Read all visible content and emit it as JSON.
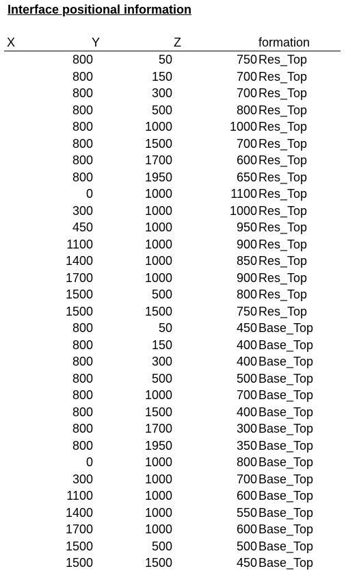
{
  "title": "Interface positional information",
  "columns": {
    "x": "X",
    "y": "Y",
    "z": "Z",
    "formation": "formation"
  },
  "rows": [
    {
      "x": "800",
      "y": "50",
      "z": "750",
      "formation": "Res_Top"
    },
    {
      "x": "800",
      "y": "150",
      "z": "700",
      "formation": "Res_Top"
    },
    {
      "x": "800",
      "y": "300",
      "z": "700",
      "formation": "Res_Top"
    },
    {
      "x": "800",
      "y": "500",
      "z": "800",
      "formation": "Res_Top"
    },
    {
      "x": "800",
      "y": "1000",
      "z": "1000",
      "formation": "Res_Top"
    },
    {
      "x": "800",
      "y": "1500",
      "z": "700",
      "formation": "Res_Top"
    },
    {
      "x": "800",
      "y": "1700",
      "z": "600",
      "formation": "Res_Top"
    },
    {
      "x": "800",
      "y": "1950",
      "z": "650",
      "formation": "Res_Top"
    },
    {
      "x": "0",
      "y": "1000",
      "z": "1100",
      "formation": "Res_Top"
    },
    {
      "x": "300",
      "y": "1000",
      "z": "1000",
      "formation": "Res_Top"
    },
    {
      "x": "450",
      "y": "1000",
      "z": "950",
      "formation": "Res_Top"
    },
    {
      "x": "1100",
      "y": "1000",
      "z": "900",
      "formation": "Res_Top"
    },
    {
      "x": "1400",
      "y": "1000",
      "z": "850",
      "formation": "Res_Top"
    },
    {
      "x": "1700",
      "y": "1000",
      "z": "900",
      "formation": "Res_Top"
    },
    {
      "x": "1500",
      "y": "500",
      "z": "800",
      "formation": "Res_Top"
    },
    {
      "x": "1500",
      "y": "1500",
      "z": "750",
      "formation": "Res_Top"
    },
    {
      "x": "800",
      "y": "50",
      "z": "450",
      "formation": "Base_Top"
    },
    {
      "x": "800",
      "y": "150",
      "z": "400",
      "formation": "Base_Top"
    },
    {
      "x": "800",
      "y": "300",
      "z": "400",
      "formation": "Base_Top"
    },
    {
      "x": "800",
      "y": "500",
      "z": "500",
      "formation": "Base_Top"
    },
    {
      "x": "800",
      "y": "1000",
      "z": "700",
      "formation": "Base_Top"
    },
    {
      "x": "800",
      "y": "1500",
      "z": "400",
      "formation": "Base_Top"
    },
    {
      "x": "800",
      "y": "1700",
      "z": "300",
      "formation": "Base_Top"
    },
    {
      "x": "800",
      "y": "1950",
      "z": "350",
      "formation": "Base_Top"
    },
    {
      "x": "0",
      "y": "1000",
      "z": "800",
      "formation": "Base_Top"
    },
    {
      "x": "300",
      "y": "1000",
      "z": "700",
      "formation": "Base_Top"
    },
    {
      "x": "1100",
      "y": "1000",
      "z": "600",
      "formation": "Base_Top"
    },
    {
      "x": "1400",
      "y": "1000",
      "z": "550",
      "formation": "Base_Top"
    },
    {
      "x": "1700",
      "y": "1000",
      "z": "600",
      "formation": "Base_Top"
    },
    {
      "x": "1500",
      "y": "500",
      "z": "500",
      "formation": "Base_Top"
    },
    {
      "x": "1500",
      "y": "1500",
      "z": "450",
      "formation": "Base_Top"
    }
  ]
}
